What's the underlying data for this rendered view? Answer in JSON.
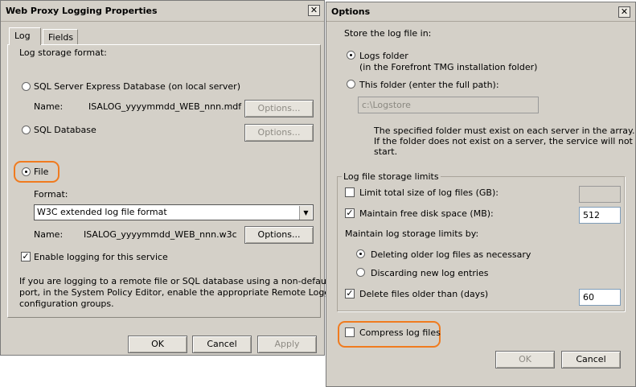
{
  "left_dialog": {
    "title": "Web Proxy Logging Properties",
    "close_glyph": "✕",
    "tabs": [
      "Log",
      "Fields"
    ],
    "storage_label": "Log storage format:",
    "sql_express": {
      "label": "SQL Server Express Database (on local server)",
      "name_label": "Name:",
      "name_value": "ISALOG_yyyymmdd_WEB_nnn.mdf",
      "options_button": "Options..."
    },
    "sql_db": {
      "label": "SQL Database",
      "options_button": "Options..."
    },
    "file": {
      "label": "File",
      "format_label": "Format:",
      "format_value": "W3C extended log file format",
      "name_label": "Name:",
      "name_value": "ISALOG_yyyymmdd_WEB_nnn.w3c",
      "options_button": "Options..."
    },
    "enable_logging_label": "Enable logging for this service",
    "info_text_lines": [
      "If you are logging to a remote file or SQL database using a non-default",
      "port, in the System Policy Editor, enable the appropriate Remote Logging",
      "configuration groups."
    ],
    "buttons": {
      "ok": "OK",
      "cancel": "Cancel",
      "apply": "Apply"
    }
  },
  "right_dialog": {
    "title": "Options",
    "close_glyph": "✕",
    "store_label": "Store the log file in:",
    "logs_folder_label": "Logs folder",
    "logs_folder_sub": "(in the Forefront TMG installation folder)",
    "this_folder_label": "This folder (enter the full path):",
    "path_value": "c:\\Logstore",
    "note_lines": [
      "The specified folder must exist on each server in the array.",
      "If the folder does not exist on a server, the service will not",
      "start."
    ],
    "limits_group_label": "Log file storage limits",
    "limit_total_label": "Limit total size of log files (GB):",
    "free_space_label": "Maintain free disk space (MB):",
    "free_space_value": "512",
    "maintain_label": "Maintain log storage limits by:",
    "delete_older_label": "Deleting older log files as necessary",
    "discard_label": "Discarding new log entries",
    "delete_days_label": "Delete files older than (days)",
    "delete_days_value": "60",
    "compress_label": "Compress log files",
    "buttons": {
      "ok": "OK",
      "cancel": "Cancel"
    }
  },
  "colors": {
    "highlight": "#f07b1f",
    "dialog_bg": "#d4d0c8"
  }
}
